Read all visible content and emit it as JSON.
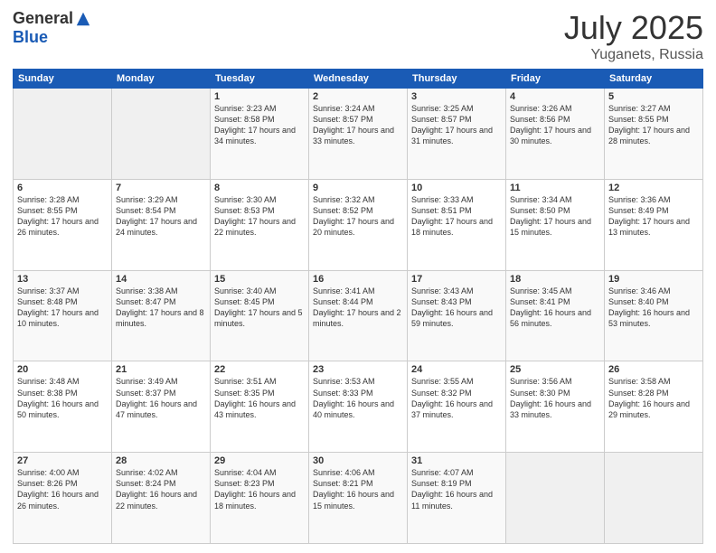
{
  "logo": {
    "general": "General",
    "blue": "Blue"
  },
  "title": {
    "month": "July 2025",
    "location": "Yuganets, Russia"
  },
  "days_of_week": [
    "Sunday",
    "Monday",
    "Tuesday",
    "Wednesday",
    "Thursday",
    "Friday",
    "Saturday"
  ],
  "weeks": [
    [
      {
        "num": "",
        "sunrise": "",
        "sunset": "",
        "daylight": ""
      },
      {
        "num": "",
        "sunrise": "",
        "sunset": "",
        "daylight": ""
      },
      {
        "num": "1",
        "sunrise": "Sunrise: 3:23 AM",
        "sunset": "Sunset: 8:58 PM",
        "daylight": "Daylight: 17 hours and 34 minutes."
      },
      {
        "num": "2",
        "sunrise": "Sunrise: 3:24 AM",
        "sunset": "Sunset: 8:57 PM",
        "daylight": "Daylight: 17 hours and 33 minutes."
      },
      {
        "num": "3",
        "sunrise": "Sunrise: 3:25 AM",
        "sunset": "Sunset: 8:57 PM",
        "daylight": "Daylight: 17 hours and 31 minutes."
      },
      {
        "num": "4",
        "sunrise": "Sunrise: 3:26 AM",
        "sunset": "Sunset: 8:56 PM",
        "daylight": "Daylight: 17 hours and 30 minutes."
      },
      {
        "num": "5",
        "sunrise": "Sunrise: 3:27 AM",
        "sunset": "Sunset: 8:55 PM",
        "daylight": "Daylight: 17 hours and 28 minutes."
      }
    ],
    [
      {
        "num": "6",
        "sunrise": "Sunrise: 3:28 AM",
        "sunset": "Sunset: 8:55 PM",
        "daylight": "Daylight: 17 hours and 26 minutes."
      },
      {
        "num": "7",
        "sunrise": "Sunrise: 3:29 AM",
        "sunset": "Sunset: 8:54 PM",
        "daylight": "Daylight: 17 hours and 24 minutes."
      },
      {
        "num": "8",
        "sunrise": "Sunrise: 3:30 AM",
        "sunset": "Sunset: 8:53 PM",
        "daylight": "Daylight: 17 hours and 22 minutes."
      },
      {
        "num": "9",
        "sunrise": "Sunrise: 3:32 AM",
        "sunset": "Sunset: 8:52 PM",
        "daylight": "Daylight: 17 hours and 20 minutes."
      },
      {
        "num": "10",
        "sunrise": "Sunrise: 3:33 AM",
        "sunset": "Sunset: 8:51 PM",
        "daylight": "Daylight: 17 hours and 18 minutes."
      },
      {
        "num": "11",
        "sunrise": "Sunrise: 3:34 AM",
        "sunset": "Sunset: 8:50 PM",
        "daylight": "Daylight: 17 hours and 15 minutes."
      },
      {
        "num": "12",
        "sunrise": "Sunrise: 3:36 AM",
        "sunset": "Sunset: 8:49 PM",
        "daylight": "Daylight: 17 hours and 13 minutes."
      }
    ],
    [
      {
        "num": "13",
        "sunrise": "Sunrise: 3:37 AM",
        "sunset": "Sunset: 8:48 PM",
        "daylight": "Daylight: 17 hours and 10 minutes."
      },
      {
        "num": "14",
        "sunrise": "Sunrise: 3:38 AM",
        "sunset": "Sunset: 8:47 PM",
        "daylight": "Daylight: 17 hours and 8 minutes."
      },
      {
        "num": "15",
        "sunrise": "Sunrise: 3:40 AM",
        "sunset": "Sunset: 8:45 PM",
        "daylight": "Daylight: 17 hours and 5 minutes."
      },
      {
        "num": "16",
        "sunrise": "Sunrise: 3:41 AM",
        "sunset": "Sunset: 8:44 PM",
        "daylight": "Daylight: 17 hours and 2 minutes."
      },
      {
        "num": "17",
        "sunrise": "Sunrise: 3:43 AM",
        "sunset": "Sunset: 8:43 PM",
        "daylight": "Daylight: 16 hours and 59 minutes."
      },
      {
        "num": "18",
        "sunrise": "Sunrise: 3:45 AM",
        "sunset": "Sunset: 8:41 PM",
        "daylight": "Daylight: 16 hours and 56 minutes."
      },
      {
        "num": "19",
        "sunrise": "Sunrise: 3:46 AM",
        "sunset": "Sunset: 8:40 PM",
        "daylight": "Daylight: 16 hours and 53 minutes."
      }
    ],
    [
      {
        "num": "20",
        "sunrise": "Sunrise: 3:48 AM",
        "sunset": "Sunset: 8:38 PM",
        "daylight": "Daylight: 16 hours and 50 minutes."
      },
      {
        "num": "21",
        "sunrise": "Sunrise: 3:49 AM",
        "sunset": "Sunset: 8:37 PM",
        "daylight": "Daylight: 16 hours and 47 minutes."
      },
      {
        "num": "22",
        "sunrise": "Sunrise: 3:51 AM",
        "sunset": "Sunset: 8:35 PM",
        "daylight": "Daylight: 16 hours and 43 minutes."
      },
      {
        "num": "23",
        "sunrise": "Sunrise: 3:53 AM",
        "sunset": "Sunset: 8:33 PM",
        "daylight": "Daylight: 16 hours and 40 minutes."
      },
      {
        "num": "24",
        "sunrise": "Sunrise: 3:55 AM",
        "sunset": "Sunset: 8:32 PM",
        "daylight": "Daylight: 16 hours and 37 minutes."
      },
      {
        "num": "25",
        "sunrise": "Sunrise: 3:56 AM",
        "sunset": "Sunset: 8:30 PM",
        "daylight": "Daylight: 16 hours and 33 minutes."
      },
      {
        "num": "26",
        "sunrise": "Sunrise: 3:58 AM",
        "sunset": "Sunset: 8:28 PM",
        "daylight": "Daylight: 16 hours and 29 minutes."
      }
    ],
    [
      {
        "num": "27",
        "sunrise": "Sunrise: 4:00 AM",
        "sunset": "Sunset: 8:26 PM",
        "daylight": "Daylight: 16 hours and 26 minutes."
      },
      {
        "num": "28",
        "sunrise": "Sunrise: 4:02 AM",
        "sunset": "Sunset: 8:24 PM",
        "daylight": "Daylight: 16 hours and 22 minutes."
      },
      {
        "num": "29",
        "sunrise": "Sunrise: 4:04 AM",
        "sunset": "Sunset: 8:23 PM",
        "daylight": "Daylight: 16 hours and 18 minutes."
      },
      {
        "num": "30",
        "sunrise": "Sunrise: 4:06 AM",
        "sunset": "Sunset: 8:21 PM",
        "daylight": "Daylight: 16 hours and 15 minutes."
      },
      {
        "num": "31",
        "sunrise": "Sunrise: 4:07 AM",
        "sunset": "Sunset: 8:19 PM",
        "daylight": "Daylight: 16 hours and 11 minutes."
      },
      {
        "num": "",
        "sunrise": "",
        "sunset": "",
        "daylight": ""
      },
      {
        "num": "",
        "sunrise": "",
        "sunset": "",
        "daylight": ""
      }
    ]
  ]
}
